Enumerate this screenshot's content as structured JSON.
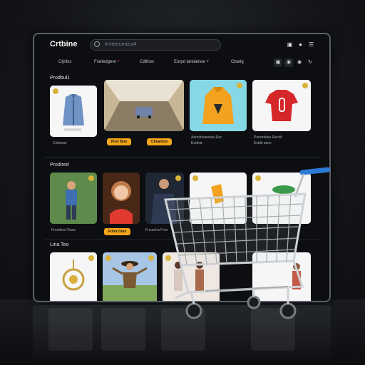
{
  "app": {
    "brand": "Crtbine",
    "search_placeholder": "lrnnterumtzut4"
  },
  "nav": {
    "items": [
      "Ctjrilos",
      "Fraitedgere",
      "Cdlihos",
      "Eorpd lareiainoe",
      "Cbarlg"
    ],
    "icons": [
      "bag-icon",
      "bell-icon",
      "cart-icon",
      "refresh-icon"
    ]
  },
  "sections": {
    "row1_title": "Prodbul1",
    "row2_title": "Prodired",
    "row3_title": "Lina Teo"
  },
  "row1": {
    "cards": [
      {
        "caption": "Cnliumer",
        "icon": "jacket-icon"
      },
      {
        "caption": "",
        "icon": "car-icon"
      },
      {
        "caption": "Aetodnlaestiaa Rsc",
        "sub": "Eodhid",
        "icon": "hoodie-icon"
      },
      {
        "caption": "Poretdolea Rerlcb",
        "sub": "Eeblit aiorc",
        "icon": "shirt-icon"
      }
    ],
    "buttons": [
      "Flvrr Boo",
      "Cheartion"
    ]
  },
  "row2": {
    "cards": [
      {
        "caption": "Fnnefarsl Daou",
        "icon": "person-icon"
      },
      {
        "caption": "",
        "icon": "portrait-icon"
      },
      {
        "caption": "Frrcacha Fom",
        "icon": "man-icon"
      },
      {
        "caption": "",
        "icon": "hat-icon"
      },
      {
        "caption": "",
        "icon": "shoe-icon"
      }
    ],
    "buttons": [
      "Fdotr Dion"
    ]
  },
  "row3": {
    "cards": [
      {
        "icon": "pendant-icon"
      },
      {
        "icon": "dancer-icon"
      },
      {
        "icon": "couple-icon"
      },
      {
        "icon": "figure-icon"
      }
    ]
  },
  "colors": {
    "accent": "#f3a51a",
    "fav": "#d9b23a",
    "cart_handle": "#2e7bd6"
  }
}
